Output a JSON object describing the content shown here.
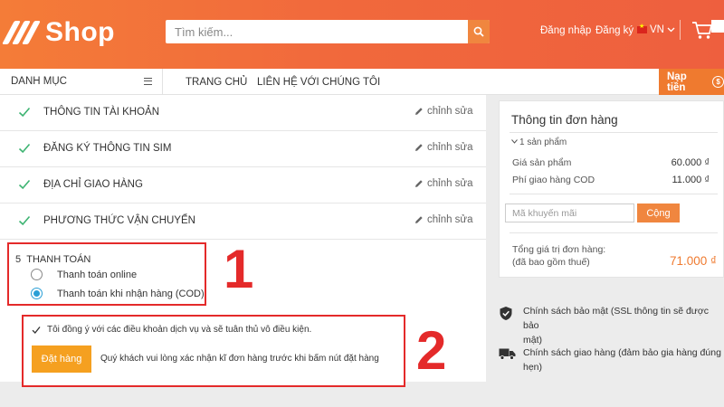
{
  "header": {
    "logo_text": "Shop",
    "search_placeholder": "Tìm kiếm...",
    "login": "Đăng nhập",
    "register": "Đăng ký",
    "language": "VN"
  },
  "nav": {
    "category": "DANH MỤC",
    "home": "TRANG CHỦ",
    "contact": "LIÊN HỆ VỚI CHÚNG TÔI",
    "topup": "Nạp tiền",
    "coin_symbol": "$"
  },
  "steps": [
    {
      "title": "THÔNG TIN TÀI KHOẢN",
      "edit": "chỉnh sửa"
    },
    {
      "title": "ĐĂNG KÝ THÔNG TIN SIM",
      "edit": "chỉnh sửa"
    },
    {
      "title": "ĐỊA CHỈ GIAO HÀNG",
      "edit": "chỉnh sửa"
    },
    {
      "title": "PHƯƠNG THỨC VẬN CHUYỂN",
      "edit": "chỉnh sửa"
    }
  ],
  "payment": {
    "number": "5",
    "title": "THANH TOÁN",
    "options": [
      {
        "label": "Thanh toán online",
        "selected": false
      },
      {
        "label": "Thanh toán khi nhận hàng (COD)",
        "selected": true
      }
    ]
  },
  "order": {
    "agree": "Tôi đồng ý với các điều khoản dịch vụ và sẽ tuân thủ vô điều kiện.",
    "button": "Đặt hàng",
    "note": "Quý khách vui lòng xác nhận kĩ đơn hàng trước khi bấm nút đặt hàng"
  },
  "annotations": {
    "label1": "1",
    "label2": "2",
    "color": "#e42a2a"
  },
  "summary": {
    "title": "Thông tin đơn hàng",
    "count": "1 sản phẩm",
    "price_label": "Giá sản phẩm",
    "price_value": "60.000 ₫",
    "ship_label": "Phí giao hàng COD",
    "ship_value": "11.000 ₫",
    "coupon_placeholder": "Mã khuyến mãi",
    "apply": "Cộng",
    "total_label_1": "Tổng giá trị đơn hàng:",
    "total_label_2": "(đã bao gồm thuế)",
    "total_value": "71.000 ₫"
  },
  "policies": [
    {
      "icon": "shield-check-icon",
      "line1": "Chính sách bảo mật (SSL thông tin sẽ được bảo",
      "line2": "mật)"
    },
    {
      "icon": "truck-icon",
      "line1": "Chính sách giao hàng (đảm bảo gia hàng đúng",
      "line2": "hẹn)"
    }
  ],
  "colors": {
    "brand": "#f1693c",
    "accent": "#ef7a2f",
    "check": "#3cb371",
    "order_button": "#f5a020",
    "radio_selected": "#2a9fd6"
  }
}
